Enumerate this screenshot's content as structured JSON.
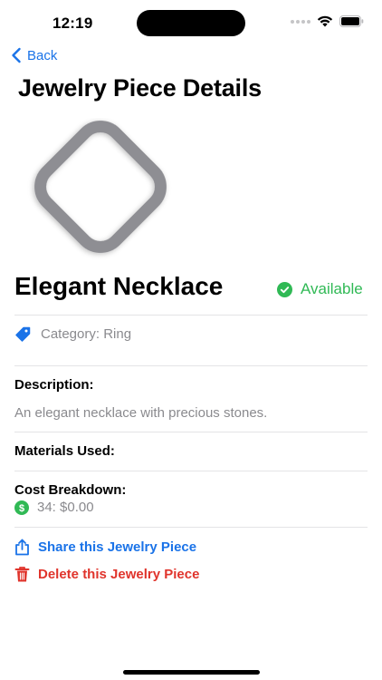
{
  "status_bar": {
    "time": "12:19"
  },
  "nav": {
    "back_label": "Back",
    "title": "Jewelry Piece Details"
  },
  "item": {
    "name": "Elegant Necklace",
    "status": "Available",
    "category": "Category: Ring",
    "description_label": "Description:",
    "description": "An elegant necklace with precious stones.",
    "materials_label": "Materials Used:",
    "cost_label": "Cost Breakdown:",
    "cost_lines": [
      "34: $0.00"
    ]
  },
  "actions": {
    "share_label": "Share this Jewelry Piece",
    "delete_label": "Delete this Jewelry Piece"
  },
  "colors": {
    "accent": "#1a73e8",
    "available": "#30b955",
    "destructive": "#e0342c",
    "placeholder_icon": "#8e8e93"
  },
  "icons": {
    "back": "chevron-left-icon",
    "placeholder": "diamond-placeholder-icon",
    "status": "checkmark-circle-icon",
    "category": "tag-icon",
    "cost": "dollar-circle-icon",
    "share": "share-icon",
    "delete": "trash-icon"
  }
}
